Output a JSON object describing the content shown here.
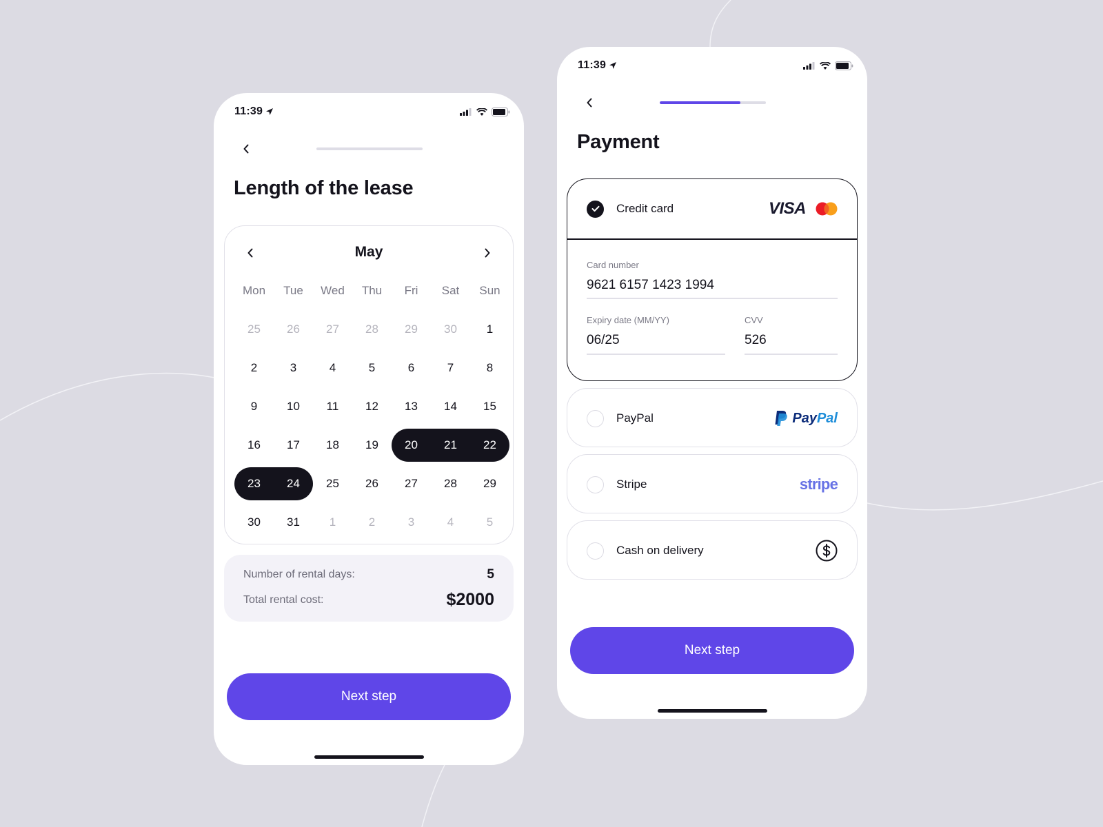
{
  "colors": {
    "accent": "#5f46e8",
    "dark": "#14131c",
    "background": "#dcdbe3",
    "muted_text": "#7a7986"
  },
  "left_screen": {
    "status": {
      "time": "11:39",
      "icons": [
        "location-arrow-icon",
        "signal-icon",
        "wifi-icon",
        "battery-icon"
      ]
    },
    "progress": 0,
    "title": "Length of the lease",
    "calendar": {
      "month": "May",
      "weekdays": [
        "Mon",
        "Tue",
        "Wed",
        "Thu",
        "Fri",
        "Sat",
        "Sun"
      ],
      "days": [
        {
          "d": "25",
          "muted": true
        },
        {
          "d": "26",
          "muted": true
        },
        {
          "d": "27",
          "muted": true
        },
        {
          "d": "28",
          "muted": true
        },
        {
          "d": "29",
          "muted": true
        },
        {
          "d": "30",
          "muted": true
        },
        {
          "d": "1"
        },
        {
          "d": "2"
        },
        {
          "d": "3"
        },
        {
          "d": "4"
        },
        {
          "d": "5"
        },
        {
          "d": "6"
        },
        {
          "d": "7"
        },
        {
          "d": "8"
        },
        {
          "d": "9"
        },
        {
          "d": "10"
        },
        {
          "d": "11"
        },
        {
          "d": "12"
        },
        {
          "d": "13"
        },
        {
          "d": "14"
        },
        {
          "d": "15"
        },
        {
          "d": "16"
        },
        {
          "d": "17"
        },
        {
          "d": "18"
        },
        {
          "d": "19"
        },
        {
          "d": "20",
          "selected": true
        },
        {
          "d": "21",
          "selected": true
        },
        {
          "d": "22",
          "selected": true
        },
        {
          "d": "23",
          "selected": true
        },
        {
          "d": "24",
          "selected": true
        },
        {
          "d": "25"
        },
        {
          "d": "26"
        },
        {
          "d": "27"
        },
        {
          "d": "28"
        },
        {
          "d": "29"
        },
        {
          "d": "30"
        },
        {
          "d": "31"
        },
        {
          "d": "1",
          "muted": true
        },
        {
          "d": "2",
          "muted": true
        },
        {
          "d": "3",
          "muted": true
        },
        {
          "d": "4",
          "muted": true
        },
        {
          "d": "5",
          "muted": true
        }
      ],
      "selected_range": [
        "20",
        "24"
      ]
    },
    "summary": {
      "days_label": "Number of rental days:",
      "days_value": "5",
      "cost_label": "Total rental cost:",
      "cost_value": "$2000"
    },
    "next_button": "Next step"
  },
  "right_screen": {
    "status": {
      "time": "11:39",
      "icons": [
        "location-arrow-icon",
        "signal-icon",
        "wifi-icon",
        "battery-icon"
      ]
    },
    "progress": 0.76,
    "title": "Payment",
    "options": [
      {
        "label": "Credit card",
        "selected": true,
        "logos": [
          "VISA",
          "mastercard"
        ]
      },
      {
        "label": "PayPal",
        "selected": false,
        "logo": "PayPal"
      },
      {
        "label": "Stripe",
        "selected": false,
        "logo": "stripe"
      },
      {
        "label": "Cash on delivery",
        "selected": false,
        "logo": "dollar-circle-icon"
      }
    ],
    "card_form": {
      "card_number_label": "Card number",
      "card_number_value": "9621 6157 1423 1994",
      "expiry_label": "Expiry date (MM/YY)",
      "expiry_value": "06/25",
      "cvv_label": "CVV",
      "cvv_value": "526"
    },
    "logos": {
      "visa": "VISA",
      "paypal_pay": "Pay",
      "paypal_pal": "Pal",
      "stripe": "stripe"
    },
    "next_button": "Next step"
  }
}
